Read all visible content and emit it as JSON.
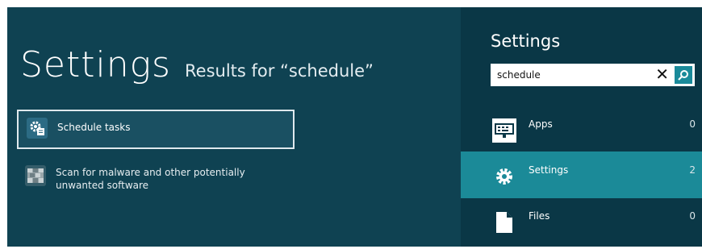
{
  "results_page": {
    "title": "Settings",
    "subtitle": "Results for “schedule”",
    "results": [
      {
        "label": "Schedule tasks",
        "icon": "schedule-tasks-icon"
      },
      {
        "label": "Scan for malware and other potentially unwanted software",
        "icon": "defender-icon"
      }
    ]
  },
  "search_pane": {
    "title": "Settings",
    "query": "schedule",
    "categories": [
      {
        "label": "Apps",
        "count": "0",
        "icon": "keyboard-icon"
      },
      {
        "label": "Settings",
        "count": "2",
        "icon": "gear-icon",
        "selected": true
      },
      {
        "label": "Files",
        "count": "0",
        "icon": "file-icon"
      }
    ]
  },
  "colors": {
    "results_bg": "#0f4252",
    "pane_bg": "#0a3746",
    "selected_category": "#1b8a98",
    "search_button": "#1a8a9a"
  }
}
